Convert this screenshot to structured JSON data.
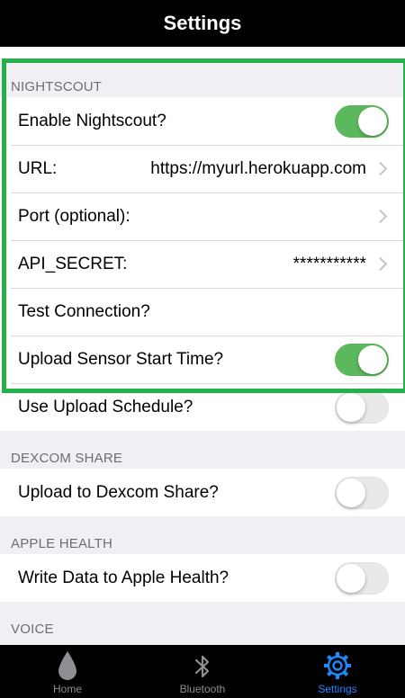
{
  "header": {
    "title": "Settings"
  },
  "nightscout": {
    "section_title": "NIGHTSCOUT",
    "enable_label": "Enable Nightscout?",
    "enable_on": true,
    "url_label": "URL:",
    "url_value": "https://myurl.herokuapp.com",
    "port_label": "Port (optional):",
    "port_value": "",
    "secret_label": "API_SECRET:",
    "secret_value": "***********",
    "test_label": "Test Connection?",
    "upload_start_label": "Upload Sensor Start Time?",
    "upload_start_on": true,
    "schedule_label": "Use Upload Schedule?",
    "schedule_on": false
  },
  "dexcom": {
    "section_title": "DEXCOM SHARE",
    "upload_label": "Upload to Dexcom Share?",
    "upload_on": false
  },
  "apple_health": {
    "section_title": "APPLE HEALTH",
    "write_label": "Write Data to Apple Health?",
    "write_on": false
  },
  "voice": {
    "section_title": "VOICE"
  },
  "tabs": [
    {
      "label": "Home",
      "icon": "drop-icon",
      "active": false
    },
    {
      "label": "Bluetooth",
      "icon": "bluetooth-icon",
      "active": false
    },
    {
      "label": "Settings",
      "icon": "gear-icon",
      "active": true
    }
  ],
  "colors": {
    "toggle_on": "#5cb85c",
    "highlight": "#24b14a",
    "active_tab": "#1e88ff",
    "inactive_tab": "#8e8e93"
  }
}
